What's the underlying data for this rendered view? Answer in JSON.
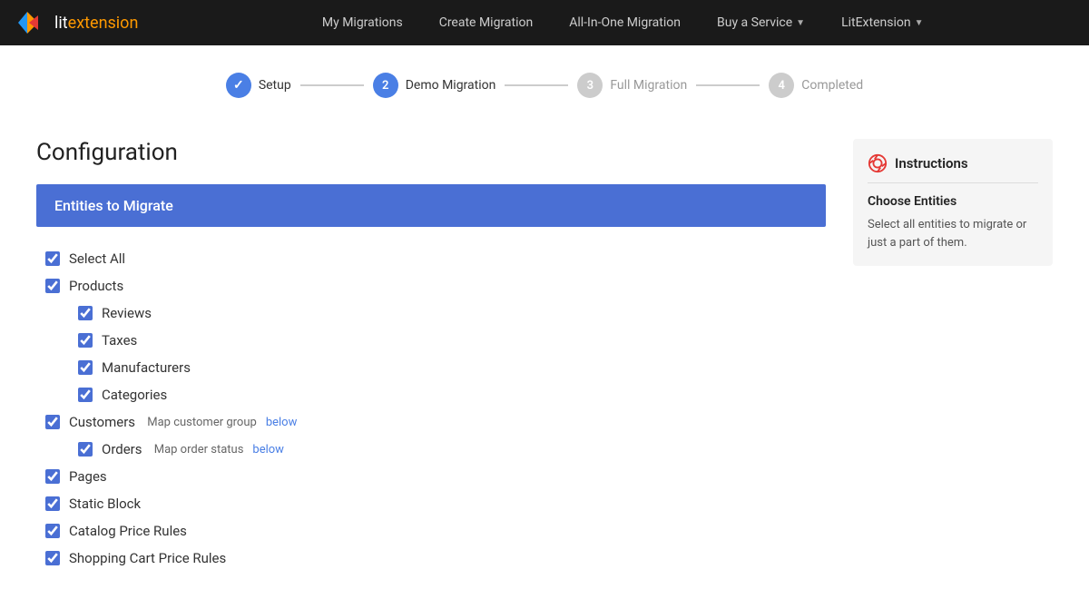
{
  "navbar": {
    "brand_lit": "lit",
    "brand_extension": "extension",
    "nav_items": [
      {
        "label": "My Migrations",
        "id": "my-migrations",
        "dropdown": false
      },
      {
        "label": "Create Migration",
        "id": "create-migration",
        "dropdown": false
      },
      {
        "label": "All-In-One Migration",
        "id": "all-in-one-migration",
        "dropdown": false
      },
      {
        "label": "Buy a Service",
        "id": "buy-service",
        "dropdown": true
      },
      {
        "label": "LitExtension",
        "id": "litextension",
        "dropdown": true
      }
    ]
  },
  "stepper": {
    "steps": [
      {
        "number": "✓",
        "label": "Setup",
        "state": "completed"
      },
      {
        "number": "2",
        "label": "Demo Migration",
        "state": "active"
      },
      {
        "number": "3",
        "label": "Full Migration",
        "state": "inactive"
      },
      {
        "number": "4",
        "label": "Completed",
        "state": "inactive"
      }
    ]
  },
  "config": {
    "title": "Configuration",
    "entities_header": "Entities to Migrate"
  },
  "entities": [
    {
      "id": "select-all",
      "label": "Select All",
      "checked": true,
      "indent": 0
    },
    {
      "id": "products",
      "label": "Products",
      "checked": true,
      "indent": 0
    },
    {
      "id": "reviews",
      "label": "Reviews",
      "checked": true,
      "indent": 1
    },
    {
      "id": "taxes",
      "label": "Taxes",
      "checked": true,
      "indent": 1
    },
    {
      "id": "manufacturers",
      "label": "Manufacturers",
      "checked": true,
      "indent": 1
    },
    {
      "id": "categories",
      "label": "Categories",
      "checked": true,
      "indent": 1
    },
    {
      "id": "customers",
      "label": "Customers",
      "checked": true,
      "indent": 0,
      "link_text": "Map customer group",
      "link_label": "below"
    },
    {
      "id": "orders",
      "label": "Orders",
      "checked": true,
      "indent": 1,
      "link_text": "Map order status",
      "link_label": "below"
    },
    {
      "id": "pages",
      "label": "Pages",
      "checked": true,
      "indent": 0
    },
    {
      "id": "static-block",
      "label": "Static Block",
      "checked": true,
      "indent": 0
    },
    {
      "id": "catalog-price-rules",
      "label": "Catalog Price Rules",
      "checked": true,
      "indent": 0
    },
    {
      "id": "shopping-cart-price-rules",
      "label": "Shopping Cart Price Rules",
      "checked": true,
      "indent": 0
    }
  ],
  "instructions": {
    "title": "Instructions",
    "section_title": "Choose Entities",
    "text": "Select all entities to migrate or just a part of them."
  }
}
